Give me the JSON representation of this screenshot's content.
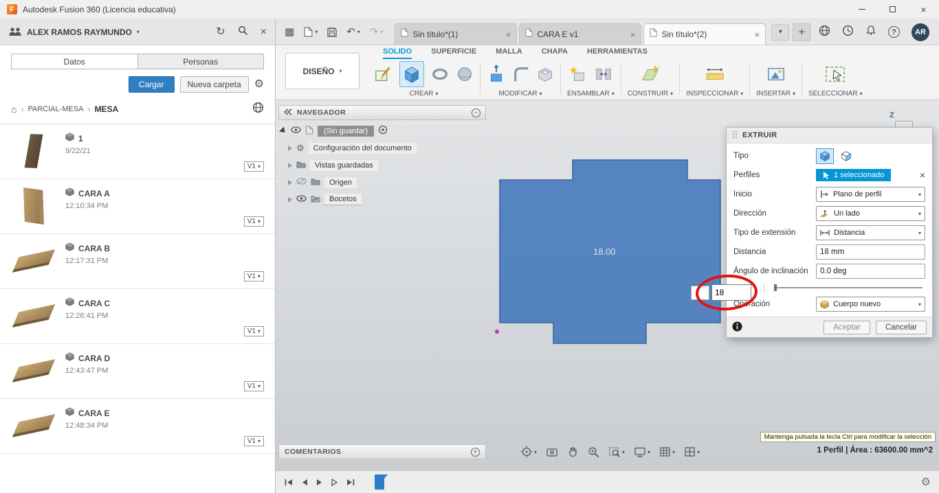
{
  "titlebar": {
    "logo": "F",
    "title": "Autodesk Fusion 360 (Licencia educativa)"
  },
  "account": {
    "initials": "AR"
  },
  "icons": {
    "close": "×",
    "refresh": "↻",
    "caret": "▾",
    "chevron": "›",
    "home": "⌂",
    "gear": "⚙",
    "minus": "−",
    "plus": "+",
    "undo": "↶",
    "redo": "↷",
    "grid_menu": "▦",
    "question": "?",
    "dots": "⋮"
  },
  "data_panel": {
    "user_name": "ALEX RAMOS RAYMUNDO",
    "tabs": [
      "Datos",
      "Personas"
    ],
    "upload_label": "Cargar",
    "new_folder_label": "Nueva carpeta",
    "breadcrumb": [
      "PARCIAL-MESA",
      "MESA"
    ],
    "items": [
      {
        "name": "1",
        "time": "9/22/21",
        "version": "V1"
      },
      {
        "name": "CARA A",
        "time": "12:10:34 PM",
        "version": "V1"
      },
      {
        "name": "CARA B",
        "time": "12:17:31 PM",
        "version": "V1"
      },
      {
        "name": "CARA C",
        "time": "12:26:41 PM",
        "version": "V1"
      },
      {
        "name": "CARA D",
        "time": "12:43:47 PM",
        "version": "V1"
      },
      {
        "name": "CARA E",
        "time": "12:48:34 PM",
        "version": "V1"
      }
    ]
  },
  "doc_tabs": [
    "Sin título*(1)",
    "CARA E v1",
    "Sin título*(2)"
  ],
  "ribbon": {
    "workspace": "DISEÑO",
    "tabs": [
      "SOLIDO",
      "SUPERFICIE",
      "MALLA",
      "CHAPA",
      "HERRAMIENTAS"
    ],
    "groups": [
      "CREAR",
      "MODIFICAR",
      "ENSAMBLAR",
      "CONSTRUIR",
      "INSPECCIONAR",
      "INSERTAR",
      "SELECCIONAR"
    ]
  },
  "navegador": {
    "title": "NAVEGADOR",
    "root": "(Sin guardar)",
    "items": [
      "Configuración del documento",
      "Vistas guardadas",
      "Origen",
      "Bocetos"
    ]
  },
  "canvas": {
    "dim_label": "18.00",
    "dim_input": "18",
    "axis_z": "Z"
  },
  "dialog": {
    "title": "EXTRUIR",
    "tipo": "Tipo",
    "perfiles": "Perfiles",
    "perfiles_value": "1 seleccionado",
    "inicio": "Inicio",
    "inicio_value": "Plano de perfil",
    "direccion": "Dirección",
    "direccion_value": "Un lado",
    "extension": "Tipo de extensión",
    "extension_value": "Distancia",
    "distancia": "Distancia",
    "distancia_value": "18 mm",
    "angulo": "Ángulo de inclinación",
    "angulo_value": "0.0 deg",
    "operacion": "Operación",
    "operacion_value": "Cuerpo nuevo",
    "ok": "Aceptar",
    "cancel": "Cancelar"
  },
  "comments": {
    "title": "COMENTARIOS"
  },
  "status": {
    "tooltip": "Mantenga pulsada la tecla Ctrl para modificar la selección",
    "selection": "1 Perfil | Área : 63600.00 mm^2"
  },
  "colors": {
    "accent": "#0696d7",
    "profile_fill": "#4a7cbd",
    "annotation_red": "#e11313",
    "upload_blue": "#2f7fc1",
    "selected_chip": "#0696d7"
  }
}
